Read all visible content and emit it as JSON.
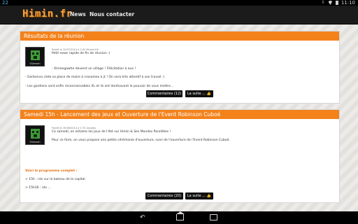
{
  "status_bar": {
    "notification": "22",
    "time": "11:10"
  },
  "nav": {
    "logo": "Himin.fr",
    "links": [
      "News",
      "Nous contacter"
    ]
  },
  "posts": [
    {
      "title": "Résultats de la réunion",
      "avatar_name": "SSeeeah",
      "meta": "Publié le 20/07/2014 à 2:00 Minehi-Kit",
      "lines": [
        "Petit news rapide de fin de réunion :)",
        "- Ximengawhe devient un village ! Félicitation à eux !",
        "- Gerbenva cède sa place de maire à crosomex à jt ! On sera très attentif à son travail :)",
        "- Les gardiens sont enfin reconnaissables XL et ils ont dorénavant le pouvoir de vous mettre..."
      ],
      "comments_label": "Commentaires (12)",
      "more_label": "La suite ..."
    },
    {
      "title": "Samedi 15h - Lancement des jeux et Ouverture de l'Event Robinson Cuboé",
      "avatar_name": "SSeeeah",
      "meta": "Publié le 19/06/2014 à 2:70 Ainsebs",
      "lines": [
        "Ce samedi, on entame les jeux de l'été sur Himin & Ses Mondes Parallèles !",
        "Pour ce faire, on vous propose une petite cérémonie d'ouverture, suivi de l'ouverture de l'Event Robinson Cuboé.",
        "Voici le programme complet :",
        "> 15h : rdv sur le bateau de la capital",
        "> 15h30 : rdv ..."
      ],
      "comments_label": "Commentaires (20)",
      "more_label": "La suite ..."
    }
  ]
}
